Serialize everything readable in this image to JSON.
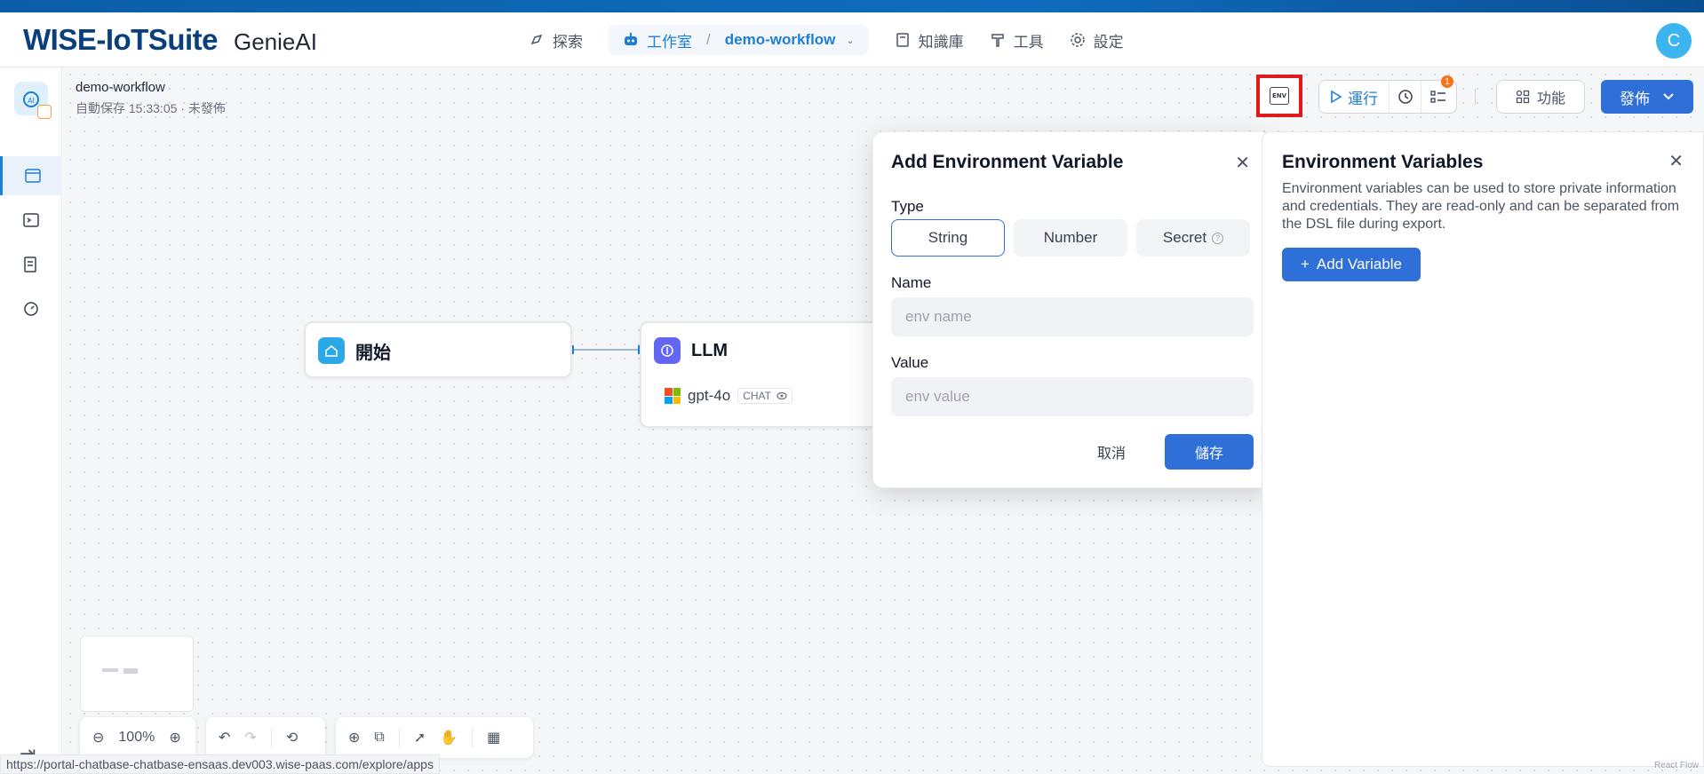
{
  "header": {
    "brand": "WISE-IoTSuite",
    "product": "GenieAI",
    "nav": {
      "explore": "探索",
      "studio": "工作室",
      "separator": "/",
      "workflow": "demo-workflow",
      "knowledge": "知識庫",
      "tools": "工具",
      "settings": "設定"
    },
    "avatar_letter": "C"
  },
  "workflow": {
    "title": "demo-workflow",
    "autosave": "自動保存 15:33:05 · 未發佈"
  },
  "toolbar": {
    "env_label": "ENV",
    "run": "運行",
    "checklist_count": "1",
    "features": "功能",
    "publish": "發佈"
  },
  "nodes": {
    "start": "開始",
    "llm": "LLM",
    "model": "gpt-4o",
    "mode": "CHAT"
  },
  "modal": {
    "title": "Add Environment Variable",
    "type_label": "Type",
    "types": [
      "String",
      "Number",
      "Secret"
    ],
    "selected_type": "String",
    "name_label": "Name",
    "name_placeholder": "env name",
    "value_label": "Value",
    "value_placeholder": "env value",
    "cancel": "取消",
    "save": "儲存"
  },
  "env_panel": {
    "title": "Environment Variables",
    "description": "Environment variables can be used to store private information and credentials. They are read-only and can be separated from the DSL file during export.",
    "add_button": "Add Variable"
  },
  "bottom_toolbar": {
    "zoom": "100%"
  },
  "status_url": "https://portal-chatbase-chatbase-ensaas.dev003.wise-paas.com/explore/apps",
  "watermark": "React Flow",
  "colors": {
    "primary": "#2f6fd8",
    "brand": "#0a3f7d",
    "highlight_border": "#e01919",
    "avatar": "#3cb4f0",
    "badge": "#f97316"
  }
}
